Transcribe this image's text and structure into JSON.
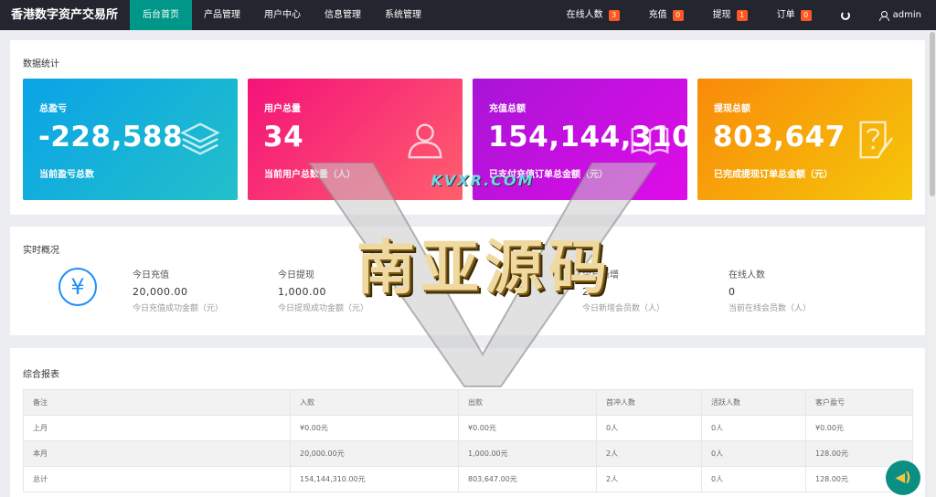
{
  "brand": "香港数字资产交易所",
  "nav": [
    {
      "label": "后台首页",
      "active": true
    },
    {
      "label": "产品管理"
    },
    {
      "label": "用户中心"
    },
    {
      "label": "信息管理"
    },
    {
      "label": "系统管理"
    }
  ],
  "right_nav": {
    "online": {
      "label": "在线人数",
      "count": "3"
    },
    "recharge": {
      "label": "充值",
      "count": "0"
    },
    "withdraw": {
      "label": "提现",
      "count": "1"
    },
    "orders": {
      "label": "订单",
      "count": "0"
    },
    "user": "admin"
  },
  "stats_panel": {
    "title": "数据统计",
    "cards": [
      {
        "label": "总盈亏",
        "value": "-228,588",
        "desc": "当前盈亏总数",
        "icon": "layers-icon"
      },
      {
        "label": "用户总量",
        "value": "34",
        "desc": "当前用户总数量（人）",
        "icon": "user-icon"
      },
      {
        "label": "充值总额",
        "value": "154,144,310",
        "desc": "已支付充值订单总金额（元）",
        "icon": "book-icon"
      },
      {
        "label": "提现总额",
        "value": "803,647",
        "desc": "已完成提现订单总金额（元）",
        "icon": "question-note-icon"
      }
    ]
  },
  "realtime_panel": {
    "title": "实时概况",
    "icon": "yen-icon",
    "icon_glyph": "¥",
    "stats": [
      {
        "label": "今日充值",
        "value": "20,000.00",
        "desc": "今日充值成功金额（元）"
      },
      {
        "label": "今日提现",
        "value": "1,000.00",
        "desc": "今日提现成功金额（元）"
      },
      {
        "label": "今日新增",
        "value": "2",
        "desc": "今日新增会员数（人）"
      },
      {
        "label": "在线人数",
        "value": "0",
        "desc": "当前在线会员数（人）"
      }
    ]
  },
  "report_panel": {
    "title": "综合报表",
    "columns": [
      "备注",
      "入款",
      "出款",
      "首冲人数",
      "活跃人数",
      "客户盈亏"
    ],
    "rows": [
      [
        "上月",
        "¥0.00元",
        "¥0.00元",
        "0人",
        "0人",
        "¥0.00元"
      ],
      [
        "本月",
        "20,000.00元",
        "1,000.00元",
        "2人",
        "0人",
        "128.00元"
      ],
      [
        "总计",
        "154,144,310.00元",
        "803,647.00元",
        "2人",
        "0人",
        "128.00元"
      ]
    ]
  },
  "watermark": {
    "site": "KVXR.COM",
    "text": "南亚源码"
  },
  "colors": {
    "topbar": "#23262e",
    "active_nav": "#009688",
    "badge": "#ff5722",
    "accent_blue": "#1e8ffb"
  }
}
